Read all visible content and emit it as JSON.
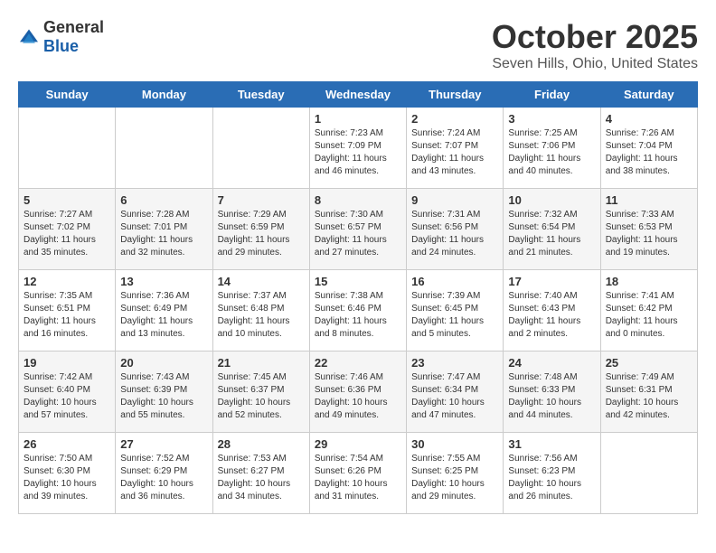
{
  "header": {
    "logo_general": "General",
    "logo_blue": "Blue",
    "title": "October 2025",
    "subtitle": "Seven Hills, Ohio, United States"
  },
  "weekdays": [
    "Sunday",
    "Monday",
    "Tuesday",
    "Wednesday",
    "Thursday",
    "Friday",
    "Saturday"
  ],
  "weeks": [
    [
      {
        "day": "",
        "info": ""
      },
      {
        "day": "",
        "info": ""
      },
      {
        "day": "",
        "info": ""
      },
      {
        "day": "1",
        "info": "Sunrise: 7:23 AM\nSunset: 7:09 PM\nDaylight: 11 hours\nand 46 minutes."
      },
      {
        "day": "2",
        "info": "Sunrise: 7:24 AM\nSunset: 7:07 PM\nDaylight: 11 hours\nand 43 minutes."
      },
      {
        "day": "3",
        "info": "Sunrise: 7:25 AM\nSunset: 7:06 PM\nDaylight: 11 hours\nand 40 minutes."
      },
      {
        "day": "4",
        "info": "Sunrise: 7:26 AM\nSunset: 7:04 PM\nDaylight: 11 hours\nand 38 minutes."
      }
    ],
    [
      {
        "day": "5",
        "info": "Sunrise: 7:27 AM\nSunset: 7:02 PM\nDaylight: 11 hours\nand 35 minutes."
      },
      {
        "day": "6",
        "info": "Sunrise: 7:28 AM\nSunset: 7:01 PM\nDaylight: 11 hours\nand 32 minutes."
      },
      {
        "day": "7",
        "info": "Sunrise: 7:29 AM\nSunset: 6:59 PM\nDaylight: 11 hours\nand 29 minutes."
      },
      {
        "day": "8",
        "info": "Sunrise: 7:30 AM\nSunset: 6:57 PM\nDaylight: 11 hours\nand 27 minutes."
      },
      {
        "day": "9",
        "info": "Sunrise: 7:31 AM\nSunset: 6:56 PM\nDaylight: 11 hours\nand 24 minutes."
      },
      {
        "day": "10",
        "info": "Sunrise: 7:32 AM\nSunset: 6:54 PM\nDaylight: 11 hours\nand 21 minutes."
      },
      {
        "day": "11",
        "info": "Sunrise: 7:33 AM\nSunset: 6:53 PM\nDaylight: 11 hours\nand 19 minutes."
      }
    ],
    [
      {
        "day": "12",
        "info": "Sunrise: 7:35 AM\nSunset: 6:51 PM\nDaylight: 11 hours\nand 16 minutes."
      },
      {
        "day": "13",
        "info": "Sunrise: 7:36 AM\nSunset: 6:49 PM\nDaylight: 11 hours\nand 13 minutes."
      },
      {
        "day": "14",
        "info": "Sunrise: 7:37 AM\nSunset: 6:48 PM\nDaylight: 11 hours\nand 10 minutes."
      },
      {
        "day": "15",
        "info": "Sunrise: 7:38 AM\nSunset: 6:46 PM\nDaylight: 11 hours\nand 8 minutes."
      },
      {
        "day": "16",
        "info": "Sunrise: 7:39 AM\nSunset: 6:45 PM\nDaylight: 11 hours\nand 5 minutes."
      },
      {
        "day": "17",
        "info": "Sunrise: 7:40 AM\nSunset: 6:43 PM\nDaylight: 11 hours\nand 2 minutes."
      },
      {
        "day": "18",
        "info": "Sunrise: 7:41 AM\nSunset: 6:42 PM\nDaylight: 11 hours\nand 0 minutes."
      }
    ],
    [
      {
        "day": "19",
        "info": "Sunrise: 7:42 AM\nSunset: 6:40 PM\nDaylight: 10 hours\nand 57 minutes."
      },
      {
        "day": "20",
        "info": "Sunrise: 7:43 AM\nSunset: 6:39 PM\nDaylight: 10 hours\nand 55 minutes."
      },
      {
        "day": "21",
        "info": "Sunrise: 7:45 AM\nSunset: 6:37 PM\nDaylight: 10 hours\nand 52 minutes."
      },
      {
        "day": "22",
        "info": "Sunrise: 7:46 AM\nSunset: 6:36 PM\nDaylight: 10 hours\nand 49 minutes."
      },
      {
        "day": "23",
        "info": "Sunrise: 7:47 AM\nSunset: 6:34 PM\nDaylight: 10 hours\nand 47 minutes."
      },
      {
        "day": "24",
        "info": "Sunrise: 7:48 AM\nSunset: 6:33 PM\nDaylight: 10 hours\nand 44 minutes."
      },
      {
        "day": "25",
        "info": "Sunrise: 7:49 AM\nSunset: 6:31 PM\nDaylight: 10 hours\nand 42 minutes."
      }
    ],
    [
      {
        "day": "26",
        "info": "Sunrise: 7:50 AM\nSunset: 6:30 PM\nDaylight: 10 hours\nand 39 minutes."
      },
      {
        "day": "27",
        "info": "Sunrise: 7:52 AM\nSunset: 6:29 PM\nDaylight: 10 hours\nand 36 minutes."
      },
      {
        "day": "28",
        "info": "Sunrise: 7:53 AM\nSunset: 6:27 PM\nDaylight: 10 hours\nand 34 minutes."
      },
      {
        "day": "29",
        "info": "Sunrise: 7:54 AM\nSunset: 6:26 PM\nDaylight: 10 hours\nand 31 minutes."
      },
      {
        "day": "30",
        "info": "Sunrise: 7:55 AM\nSunset: 6:25 PM\nDaylight: 10 hours\nand 29 minutes."
      },
      {
        "day": "31",
        "info": "Sunrise: 7:56 AM\nSunset: 6:23 PM\nDaylight: 10 hours\nand 26 minutes."
      },
      {
        "day": "",
        "info": ""
      }
    ]
  ]
}
